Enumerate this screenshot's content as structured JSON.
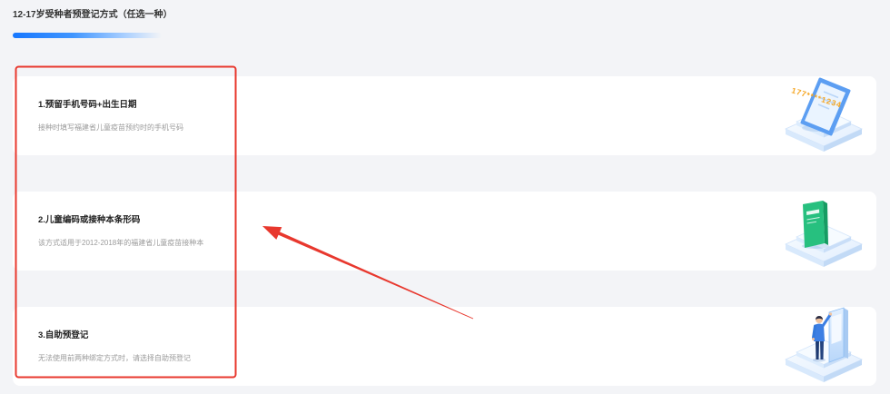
{
  "header": {
    "title": "12-17岁受种者预登记方式（任选一种）"
  },
  "options": [
    {
      "title": "1.预留手机号码+出生日期",
      "description": "接种时填写福建省儿童疫苗预约时的手机号码",
      "illustration_icon": "phone-number-illustration",
      "illustration_text": "177****1234"
    },
    {
      "title": "2.儿童编码或接种本条形码",
      "description": "该方式适用于2012-2018年的福建省儿童疫苗接种本",
      "illustration_icon": "vaccination-booklet-illustration"
    },
    {
      "title": "3.自助预登记",
      "description": "无法使用前两种绑定方式时，请选择自助预登记",
      "illustration_icon": "self-registration-kiosk-illustration"
    }
  ],
  "annotations": {
    "highlight_box_icon": "red-highlight-box",
    "arrow_icon": "red-arrow-pointer"
  },
  "colors": {
    "page_background": "#f3f4f7",
    "card_background": "#ffffff",
    "accent": "#1677ff",
    "annotation_red": "#e8382e",
    "illustration_number": "#f5a623",
    "booklet_green": "#27c07f"
  }
}
